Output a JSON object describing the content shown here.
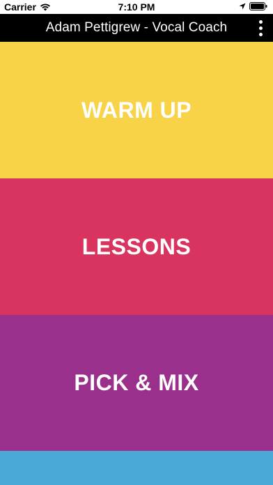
{
  "status_bar": {
    "carrier": "Carrier",
    "time": "7:10 PM",
    "icons": [
      "wifi-icon",
      "location-arrow-icon",
      "battery-icon"
    ]
  },
  "header": {
    "title": "Adam Pettigrew - Vocal Coach",
    "menu_icon": "more-vertical-icon"
  },
  "tiles": [
    {
      "label": "WARM UP",
      "color": "#f8d348"
    },
    {
      "label": "LESSONS",
      "color": "#d93460"
    },
    {
      "label": "PICK & MIX",
      "color": "#9b2f8c"
    },
    {
      "label": "",
      "color": "#4aa8d6"
    }
  ]
}
